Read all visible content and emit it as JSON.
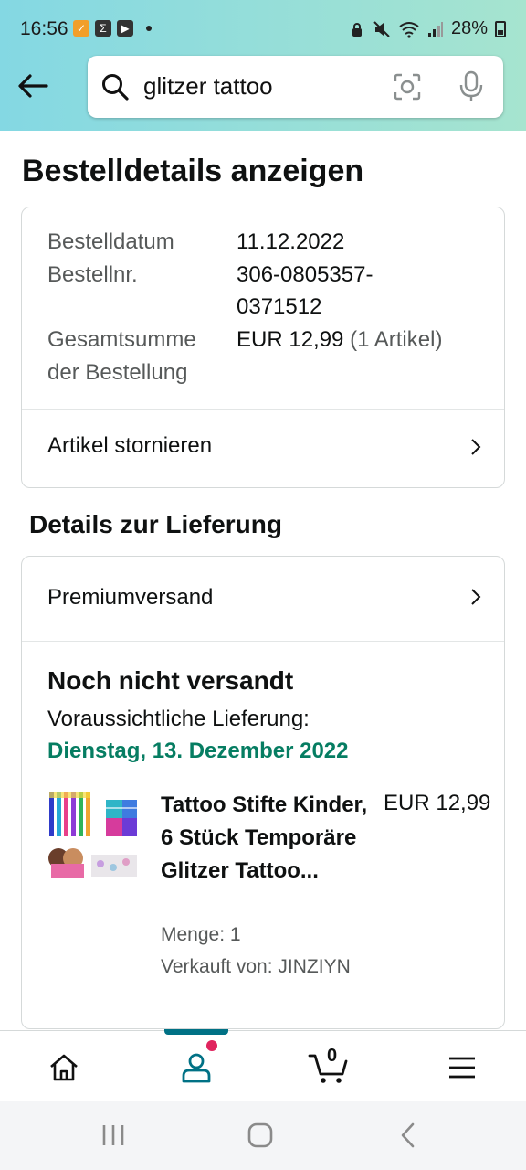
{
  "status_bar": {
    "time": "16:56",
    "battery": "28%"
  },
  "search": {
    "query": "glitzer tattoo"
  },
  "page": {
    "title": "Bestelldetails anzeigen"
  },
  "order_summary": {
    "date_label": "Bestelldatum",
    "date_value": "11.12.2022",
    "number_label": "Bestellnr.",
    "number_value_line1": "306-0805357-",
    "number_value_line2": "0371512",
    "total_label_line1": "Gesamtsumme",
    "total_label_line2": "der Bestellung",
    "total_value": "EUR 12,99",
    "total_items": "(1 Artikel)",
    "cancel_label": "Artikel stornieren"
  },
  "delivery": {
    "section_title": "Details zur Lieferung",
    "shipping_method": "Premiumversand",
    "status": "Noch nicht versandt",
    "expected_label": "Voraussichtliche Lieferung:",
    "expected_date": "Dienstag, 13. Dezember 2022",
    "date_color": "#067d62"
  },
  "item": {
    "title": "Tattoo Stifte Kinder, 6 Stück Temporäre Glitzer Tattoo...",
    "price": "EUR 12,99",
    "quantity": "Menge: 1",
    "seller": "Verkauft von: JINZIYN"
  },
  "bottom_nav": {
    "cart_count": "0",
    "active_tab": "account",
    "accent": "#007185"
  },
  "icons": [
    "back-arrow-icon",
    "search-icon",
    "camera-icon",
    "mic-icon",
    "chevron-right-icon",
    "home-icon",
    "account-icon",
    "cart-icon",
    "menu-icon"
  ]
}
